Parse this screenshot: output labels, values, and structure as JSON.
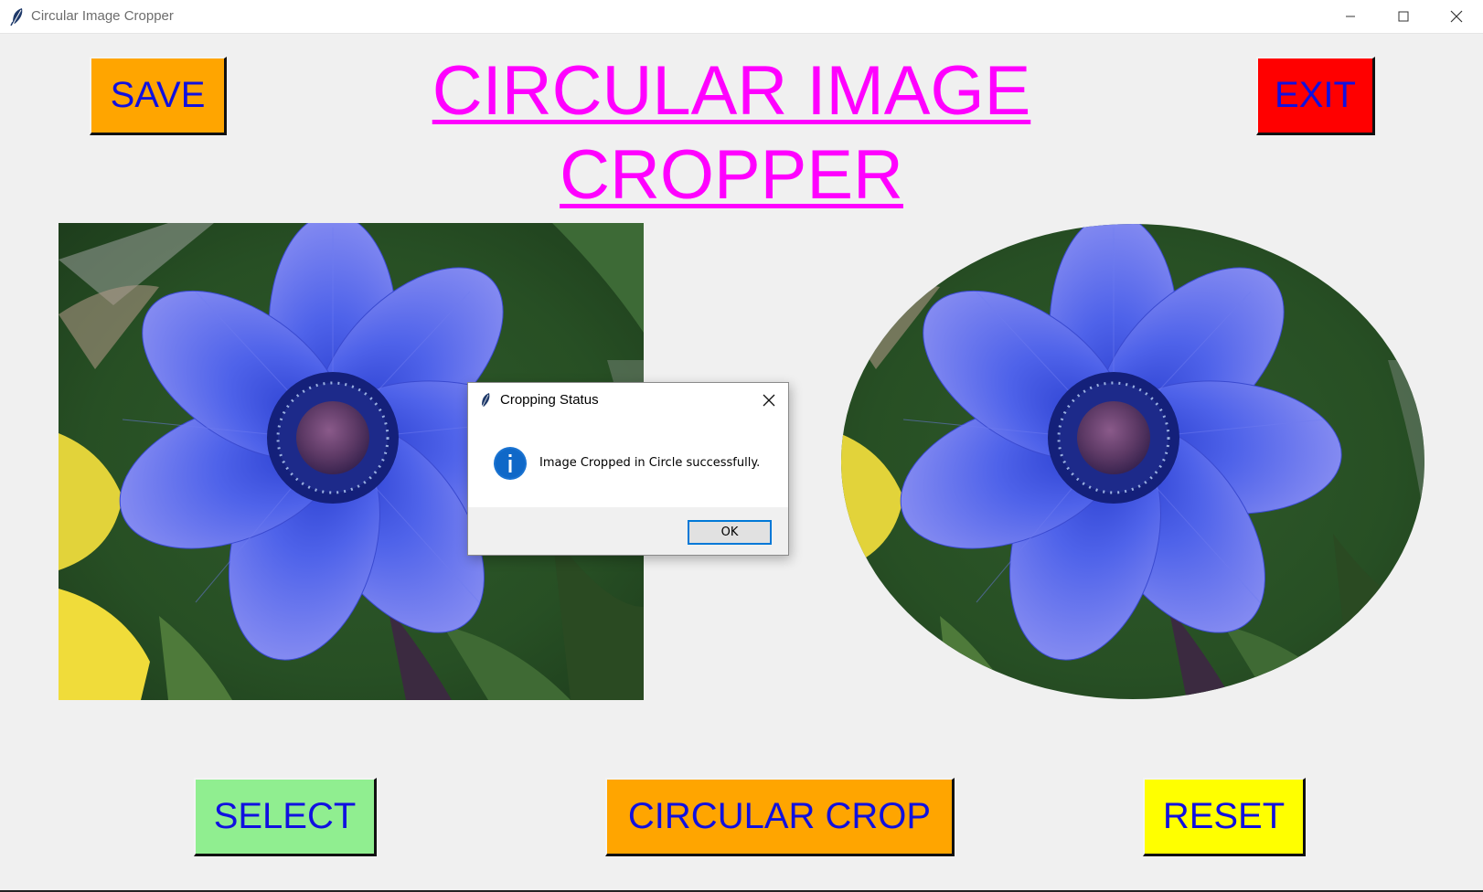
{
  "window": {
    "title": "Circular Image Cropper"
  },
  "heading": {
    "line1": "CIRCULAR IMAGE",
    "line2": "CROPPER",
    "color": "#ff00ff"
  },
  "buttons": {
    "save": "SAVE",
    "exit": "EXIT",
    "select": "SELECT",
    "circular_crop": "CIRCULAR CROP",
    "reset": "RESET"
  },
  "images": {
    "original": "blue-anemone-flower-photo",
    "cropped": "blue-anemone-flower-circular-crop"
  },
  "dialog": {
    "title": "Cropping Status",
    "message": "Image Cropped in Circle successfully.",
    "ok_label": "OK",
    "icon": "info-icon"
  },
  "colors": {
    "save_bg": "#ffa500",
    "exit_bg": "#ff0000",
    "select_bg": "#90ee90",
    "crop_bg": "#ffa500",
    "reset_bg": "#ffff00",
    "button_text": "#1010e0"
  }
}
